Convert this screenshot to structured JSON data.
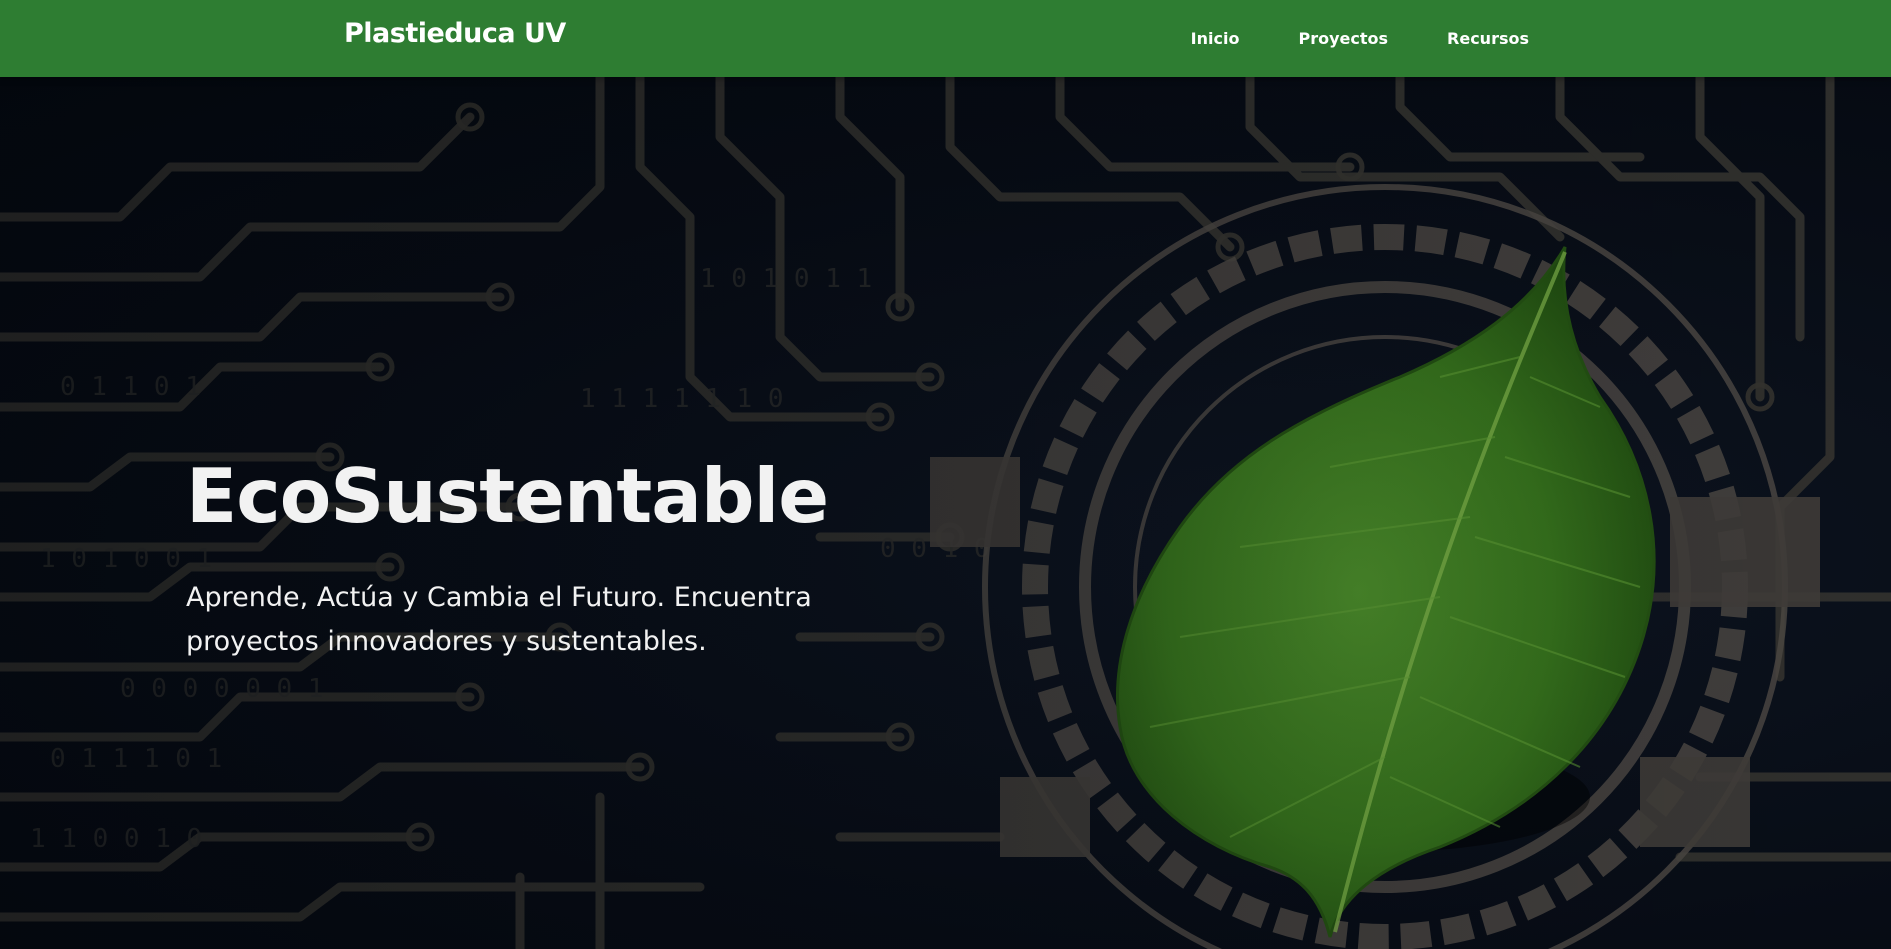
{
  "navbar": {
    "brand": "Plastieduca UV",
    "links": [
      {
        "label": "Inicio"
      },
      {
        "label": "Proyectos"
      },
      {
        "label": "Recursos"
      }
    ],
    "color": "#2e7d32"
  },
  "hero": {
    "title": "EcoSustentable",
    "subtitle": "Aprende, Actúa y Cambia el Futuro. Encuentra proyectos innovadores y sustentables.",
    "background_icon": "leaf-on-circuit-board",
    "colors": {
      "background": "#060b14",
      "circuit": "#3a3a36",
      "leaf": "#3c7a22",
      "text": "#f2f2f2"
    }
  }
}
